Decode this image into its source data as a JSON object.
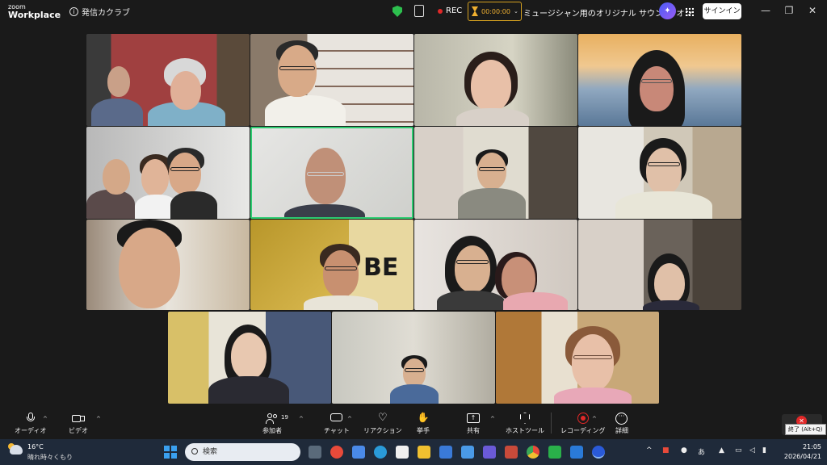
{
  "titlebar": {
    "logo_line1": "zoom",
    "logo_line2": "Workplace",
    "meeting_name": "発信カクラブ",
    "rec_label": "REC",
    "timer": "00:00:00",
    "sound_label": "ミュージシャン用のオリジナル サウンド: オン",
    "signin_label": "サインイン",
    "minimize": "—",
    "restore": "❐",
    "close": "✕"
  },
  "toolbar": {
    "audio": "オーディオ",
    "video": "ビデオ",
    "participants": "参加者",
    "participants_count": "19",
    "chat": "チャット",
    "reactions": "リアクション",
    "raise_hand": "挙手",
    "share": "共有",
    "host_tools": "ホストツール",
    "recording": "レコーディング",
    "more": "詳細",
    "end_tooltip": "終了 (Alt+Q)"
  },
  "taskbar": {
    "temperature": "16°C",
    "weather": "晴れ時々くもり",
    "search_placeholder": "検索",
    "time": "21:05",
    "date": "2026/04/21",
    "ime": "あ"
  },
  "colors": {
    "active_speaker_border": "#2ecc71",
    "timer_accent": "#f0b030",
    "rec_red": "#e02828"
  }
}
